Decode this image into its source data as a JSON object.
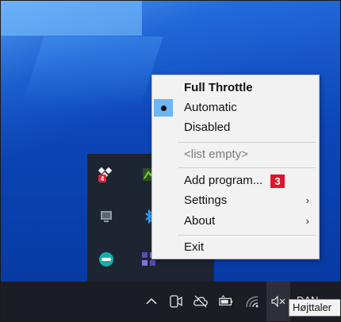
{
  "context_menu": {
    "title": "Full Throttle",
    "items": [
      {
        "label": "Automatic",
        "checked": true
      },
      {
        "label": "Disabled",
        "checked": false
      }
    ],
    "list_empty": "<list empty>",
    "add_program": "Add program...",
    "badge": "3",
    "settings": "Settings",
    "about": "About",
    "submenu_arrow": "›",
    "exit": "Exit"
  },
  "taskbar": {
    "language": "DAN",
    "tooltip": "Højttaler"
  },
  "colors": {
    "menu_bg": "#f2f2f2",
    "highlight": "#6cb6f2",
    "badge": "#d9162b",
    "taskbar": "#1b1d24",
    "tray": "#1d2533"
  },
  "icons": {
    "tray": [
      "dropbox-icon",
      "app-icon",
      "monitor-icon",
      "bluetooth-icon",
      "teal-app-icon",
      "grid-app-icon"
    ],
    "taskbar": [
      "chevron-up-icon",
      "camera-icon",
      "cloud-offline-icon",
      "battery-icon",
      "wifi-icon",
      "speaker-muted-icon"
    ]
  }
}
